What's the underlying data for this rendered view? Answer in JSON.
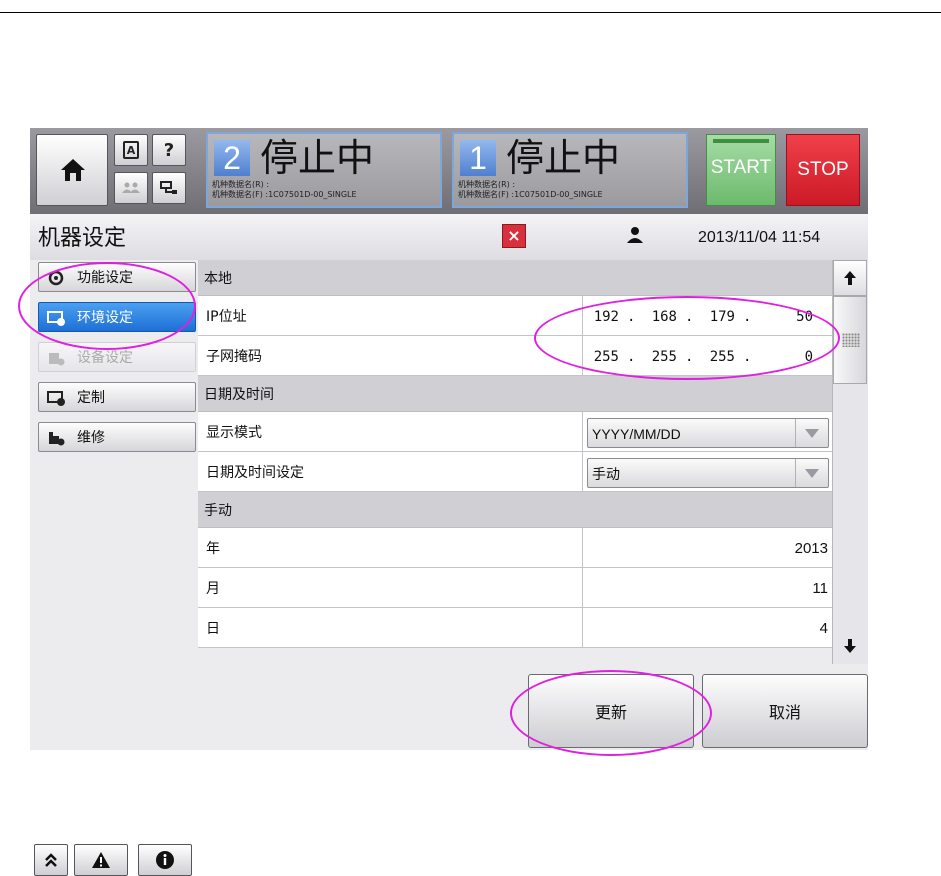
{
  "header": {
    "machine_status": [
      {
        "number": "2",
        "status": "停止中",
        "info_r": "机种数据名(R) :",
        "info_f": "机种数据名(F) :1C07501D-00_SINGLE"
      },
      {
        "number": "1",
        "status": "停止中",
        "info_r": "机种数据名(R) :",
        "info_f": "机种数据名(F) :1C07501D-00_SINGLE"
      }
    ],
    "small_buttons": {
      "language_glyph": "A",
      "help_glyph": "?"
    },
    "start_label": "START",
    "stop_label": "STOP"
  },
  "titlebar": {
    "title": "机器设定",
    "close_glyph": "×",
    "datetime": "2013/11/04 11:54"
  },
  "sidebar": {
    "items": [
      {
        "label": "功能设定",
        "icon": "function-settings-icon",
        "state": "normal"
      },
      {
        "label": "环境设定",
        "icon": "environment-settings-icon",
        "state": "active"
      },
      {
        "label": "设备设定",
        "icon": "device-settings-icon",
        "state": "disabled"
      },
      {
        "label": "定制",
        "icon": "customize-icon",
        "state": "normal"
      },
      {
        "label": "维修",
        "icon": "maintenance-icon",
        "state": "normal"
      }
    ],
    "bottom_buttons": [
      "double-chevron-up-icon",
      "warning-icon",
      "info-icon"
    ]
  },
  "settings": {
    "local_section": "本地",
    "ip_label": "IP位址",
    "ip": [
      "192",
      "168",
      "179",
      "50"
    ],
    "mask_label": "子网掩码",
    "mask": [
      "255",
      "255",
      "255",
      "0"
    ],
    "datetime_section": "日期及时间",
    "display_mode_label": "显示模式",
    "display_mode_value": "YYYY/MM/DD",
    "datetime_setting_label": "日期及时间设定",
    "datetime_setting_value": "手动",
    "manual_section": "手动",
    "year_label": "年",
    "year_value": "2013",
    "month_label": "月",
    "month_value": "11",
    "day_label": "日",
    "day_value": "4"
  },
  "footer": {
    "update_label": "更新",
    "cancel_label": "取消"
  },
  "colors": {
    "accent_blue": "#1e6fd6",
    "start_green": "#6cba6c",
    "stop_red": "#cc1a26",
    "annotation_magenta": "#e020e0"
  }
}
